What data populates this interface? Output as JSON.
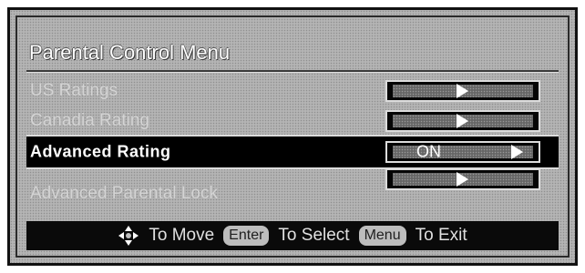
{
  "menu": {
    "title": "Parental Control Menu",
    "rows": [
      {
        "label": "US Ratings",
        "value": ""
      },
      {
        "label": "Canadia Rating",
        "value": ""
      },
      {
        "label": "Advanced Rating",
        "value": "ON"
      },
      {
        "label": "Advanced Parental Lock",
        "value": ""
      }
    ]
  },
  "footer": {
    "move_text": "To Move",
    "enter_key": "Enter",
    "select_text": "To Select",
    "menu_key": "Menu",
    "exit_text": "To Exit"
  },
  "icons": {
    "navigate": "dpad-icon",
    "submenu": "arrow-right-icon"
  },
  "colors": {
    "panel": "#b4b4b4",
    "selected_row": "#000000",
    "text": "#ffffff"
  }
}
